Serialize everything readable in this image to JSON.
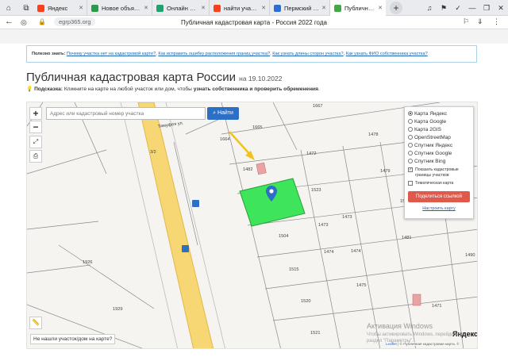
{
  "browser": {
    "tabs": [
      {
        "title": "Яндекс",
        "fav": "#fc3f1d"
      },
      {
        "title": "Новое объявле...",
        "fav": "#2b9a4b"
      },
      {
        "title": "Онлайн подача...",
        "fav": "#1ca36f"
      },
      {
        "title": "найти участок п...",
        "fav": "#fc3f1d"
      },
      {
        "title": "Пермский край...",
        "fav": "#2a6ed6"
      },
      {
        "title": "Публичная када...",
        "fav": "#45a845"
      }
    ],
    "url": "egrp365.org",
    "page_title": "Публичная кадастровая карта - Россия 2022 года"
  },
  "tips": {
    "label": "Полезно знать:",
    "links": [
      "Почему участка нет на кадастровой карте?",
      "Как исправить ошибку расположения границ участка?",
      "Как узнать длины сторон участка?",
      "Как узнать ФИО собственника участка?"
    ]
  },
  "heading": {
    "title": "Публичная кадастровая карта России",
    "date": "на 19.10.2022"
  },
  "hint": {
    "label": "Подсказка:",
    "text": "Кликните на карте на любой участок или дом, чтобы",
    "bold": "узнать собственника и проверить обременения",
    "end": "."
  },
  "map": {
    "search_placeholder": "Адрес или кадастровый номер участка",
    "find_button": "Найти",
    "zoom_in": "+",
    "zoom_out": "−",
    "layers": [
      "Карта Яндекс",
      "Карта Google",
      "Карта 2GIS",
      "OpenStreetMap",
      "Спутник Яндекс",
      "Спутник Google",
      "Спутник Bing"
    ],
    "selected_layer": "Карта Яндекс",
    "checkbox_borders": "Показать кадастровые границы участков",
    "checkbox_borders_checked": true,
    "checkbox_thematic": "Тематическая карта",
    "checkbox_thematic_checked": false,
    "share_button": "Поделиться ссылкой",
    "setup_link": "Настроить карту",
    "not_found_button": "Не нашли участок/дом на карте?",
    "brand": "Яндекс",
    "attribution_leaflet": "Leaflet",
    "attribution_text": "© Публичная кадастровая карта, ©",
    "parcel_labels": [
      "1667",
      "1665",
      "1664",
      "1478",
      "1472",
      "1482",
      "1479",
      "1523",
      "1473",
      "1473",
      "1504",
      "1481",
      "1474",
      "1474",
      "1515",
      "1490",
      "1520",
      "1475",
      "1521",
      "1926",
      "1471",
      "1929",
      "3/2",
      "1524"
    ],
    "road_label": "Тимуфея ул."
  },
  "watermark": {
    "title": "Активация Windows",
    "line1": "Чтобы активировать Windows, перейдите в",
    "line2": "раздел \"Параметры\"."
  },
  "colors": {
    "selected_parcel": "#3ee55a",
    "road": "#f7d774",
    "accent": "#2c6fc4",
    "share": "#e05a4b"
  }
}
